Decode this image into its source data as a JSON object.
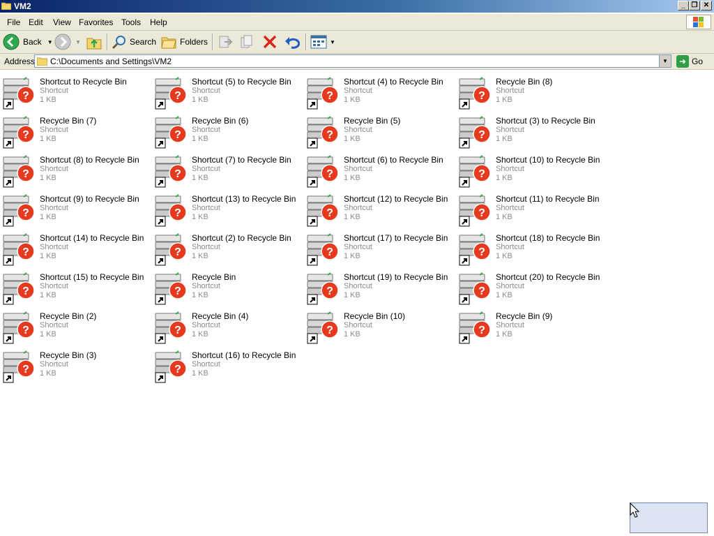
{
  "window": {
    "title": "VM2",
    "min_label": "_",
    "max_label": "❒",
    "close_label": "✕"
  },
  "menu": [
    "File",
    "Edit",
    "View",
    "Favorites",
    "Tools",
    "Help"
  ],
  "toolbar": {
    "back_label": "Back",
    "search_label": "Search",
    "folders_label": "Folders"
  },
  "address": {
    "label": "Address",
    "path": "C:\\Documents and Settings\\VM2",
    "go_label": "Go"
  },
  "files": [
    {
      "name": "Shortcut to Recycle Bin",
      "type": "Shortcut",
      "size": "1 KB"
    },
    {
      "name": "Shortcut (5) to Recycle Bin",
      "type": "Shortcut",
      "size": "1 KB"
    },
    {
      "name": "Shortcut (4) to Recycle Bin",
      "type": "Shortcut",
      "size": "1 KB"
    },
    {
      "name": "Recycle Bin (8)",
      "type": "Shortcut",
      "size": "1 KB"
    },
    {
      "name": "Recycle Bin (7)",
      "type": "Shortcut",
      "size": "1 KB"
    },
    {
      "name": "Recycle Bin (6)",
      "type": "Shortcut",
      "size": "1 KB"
    },
    {
      "name": "Recycle Bin (5)",
      "type": "Shortcut",
      "size": "1 KB"
    },
    {
      "name": "Shortcut (3) to Recycle Bin",
      "type": "Shortcut",
      "size": "1 KB"
    },
    {
      "name": "Shortcut (8) to Recycle Bin",
      "type": "Shortcut",
      "size": "1 KB"
    },
    {
      "name": "Shortcut (7) to Recycle Bin",
      "type": "Shortcut",
      "size": "1 KB"
    },
    {
      "name": "Shortcut (6) to Recycle Bin",
      "type": "Shortcut",
      "size": "1 KB"
    },
    {
      "name": "Shortcut (10) to Recycle Bin",
      "type": "Shortcut",
      "size": "1 KB"
    },
    {
      "name": "Shortcut (9) to Recycle Bin",
      "type": "Shortcut",
      "size": "1 KB"
    },
    {
      "name": "Shortcut (13) to Recycle Bin",
      "type": "Shortcut",
      "size": "1 KB"
    },
    {
      "name": "Shortcut (12) to Recycle Bin",
      "type": "Shortcut",
      "size": "1 KB"
    },
    {
      "name": "Shortcut (11) to Recycle Bin",
      "type": "Shortcut",
      "size": "1 KB"
    },
    {
      "name": "Shortcut (14) to Recycle Bin",
      "type": "Shortcut",
      "size": "1 KB"
    },
    {
      "name": "Shortcut (2) to Recycle Bin",
      "type": "Shortcut",
      "size": "1 KB"
    },
    {
      "name": "Shortcut (17) to Recycle Bin",
      "type": "Shortcut",
      "size": "1 KB"
    },
    {
      "name": "Shortcut (18) to Recycle Bin",
      "type": "Shortcut",
      "size": "1 KB"
    },
    {
      "name": "Shortcut (15) to Recycle Bin",
      "type": "Shortcut",
      "size": "1 KB"
    },
    {
      "name": "Recycle Bin",
      "type": "Shortcut",
      "size": "1 KB"
    },
    {
      "name": "Shortcut (19) to Recycle Bin",
      "type": "Shortcut",
      "size": "1 KB"
    },
    {
      "name": "Shortcut (20) to Recycle Bin",
      "type": "Shortcut",
      "size": "1 KB"
    },
    {
      "name": "Recycle Bin (2)",
      "type": "Shortcut",
      "size": "1 KB"
    },
    {
      "name": "Recycle Bin (4)",
      "type": "Shortcut",
      "size": "1 KB"
    },
    {
      "name": "Recycle Bin (10)",
      "type": "Shortcut",
      "size": "1 KB"
    },
    {
      "name": "Recycle Bin (9)",
      "type": "Shortcut",
      "size": "1 KB"
    },
    {
      "name": "Recycle Bin (3)",
      "type": "Shortcut",
      "size": "1 KB"
    },
    {
      "name": "Shortcut (16) to Recycle Bin",
      "type": "Shortcut",
      "size": "1 KB"
    }
  ],
  "colors": {
    "titlebar": "#0a246a",
    "chrome": "#ece9d8",
    "error_badge": "#e53a1e"
  }
}
